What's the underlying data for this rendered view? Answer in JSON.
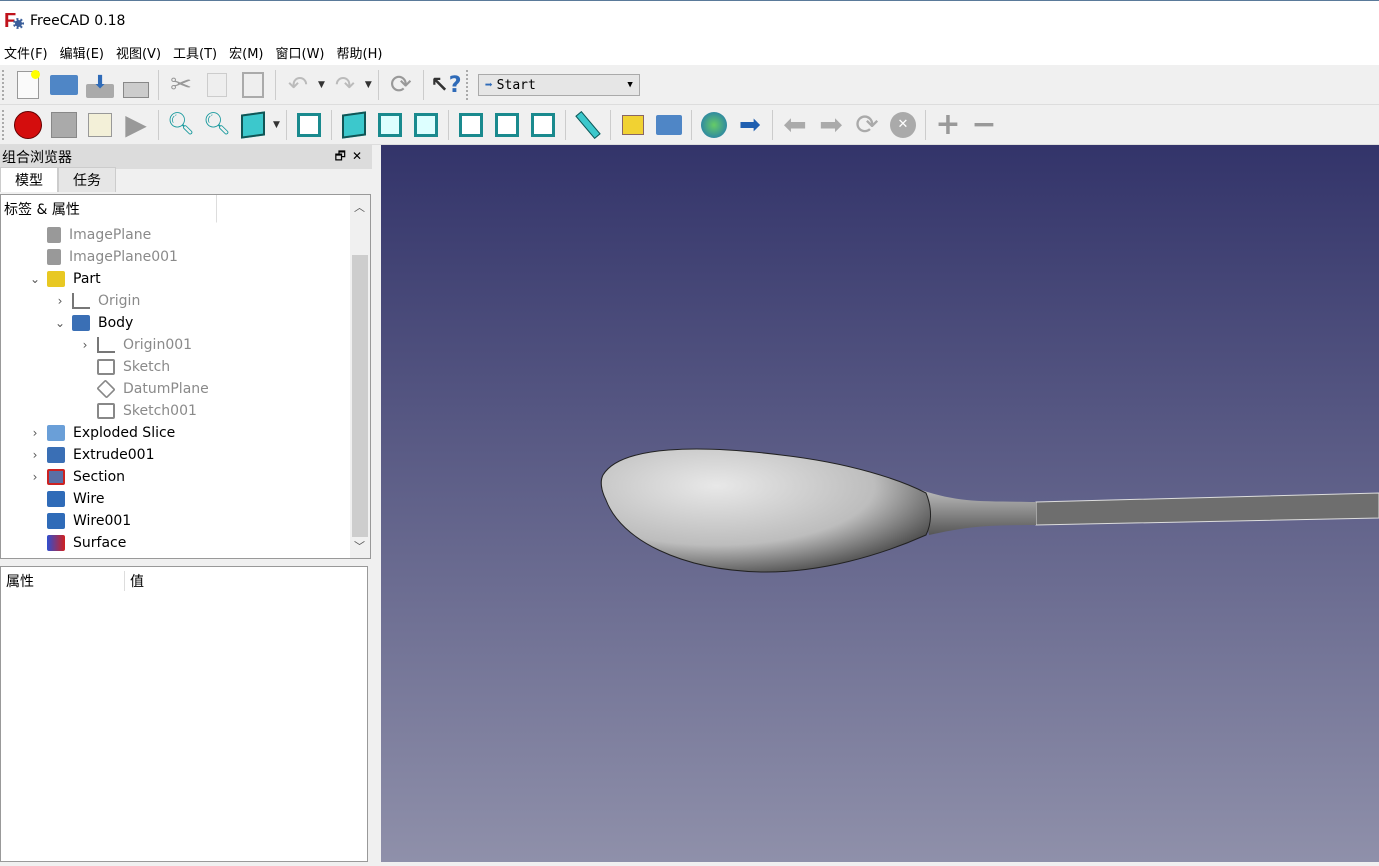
{
  "window": {
    "title": "FreeCAD 0.18"
  },
  "menu": [
    "文件(F)",
    "编辑(E)",
    "视图(V)",
    "工具(T)",
    "宏(M)",
    "窗口(W)",
    "帮助(H)"
  ],
  "toolbar": {
    "workbench": "Start"
  },
  "combo": {
    "title": "组合浏览器",
    "tabs": [
      "模型",
      "任务"
    ],
    "tree_header": "标签 & 属性",
    "items": [
      {
        "label": "ImagePlane",
        "icon": "image-plane-icon",
        "depth": 1,
        "expander": "",
        "dim": true
      },
      {
        "label": "ImagePlane001",
        "icon": "image-plane-icon",
        "depth": 1,
        "expander": "",
        "dim": true
      },
      {
        "label": "Part",
        "icon": "part-icon",
        "depth": 1,
        "expander": "expanded",
        "dim": false
      },
      {
        "label": "Origin",
        "icon": "origin-icon",
        "depth": 2,
        "expander": "collapsed",
        "dim": true
      },
      {
        "label": "Body",
        "icon": "body-icon",
        "depth": 2,
        "expander": "expanded",
        "dim": false
      },
      {
        "label": "Origin001",
        "icon": "origin-icon",
        "depth": 3,
        "expander": "collapsed",
        "dim": true
      },
      {
        "label": "Sketch",
        "icon": "sketch-icon",
        "depth": 3,
        "expander": "",
        "dim": true
      },
      {
        "label": "DatumPlane",
        "icon": "datum-plane-icon",
        "depth": 3,
        "expander": "",
        "dim": true
      },
      {
        "label": "Sketch001",
        "icon": "sketch-icon",
        "depth": 3,
        "expander": "",
        "dim": true
      },
      {
        "label": "Exploded Slice",
        "icon": "folder-icon",
        "depth": 1,
        "expander": "collapsed",
        "dim": false
      },
      {
        "label": "Extrude001",
        "icon": "extrude-icon",
        "depth": 1,
        "expander": "collapsed",
        "dim": false
      },
      {
        "label": "Section",
        "icon": "section-icon",
        "depth": 1,
        "expander": "collapsed",
        "dim": false
      },
      {
        "label": "Wire",
        "icon": "wire-icon",
        "depth": 1,
        "expander": "",
        "dim": false
      },
      {
        "label": "Wire001",
        "icon": "wire-icon",
        "depth": 1,
        "expander": "",
        "dim": false
      },
      {
        "label": "Surface",
        "icon": "surface-icon",
        "depth": 1,
        "expander": "",
        "dim": false
      }
    ]
  },
  "properties": {
    "col_property": "属性",
    "col_value": "值"
  },
  "colors": {
    "viewport_top": "#33346a",
    "viewport_bottom": "#8f90aa",
    "accent": "#3cc8cc"
  }
}
